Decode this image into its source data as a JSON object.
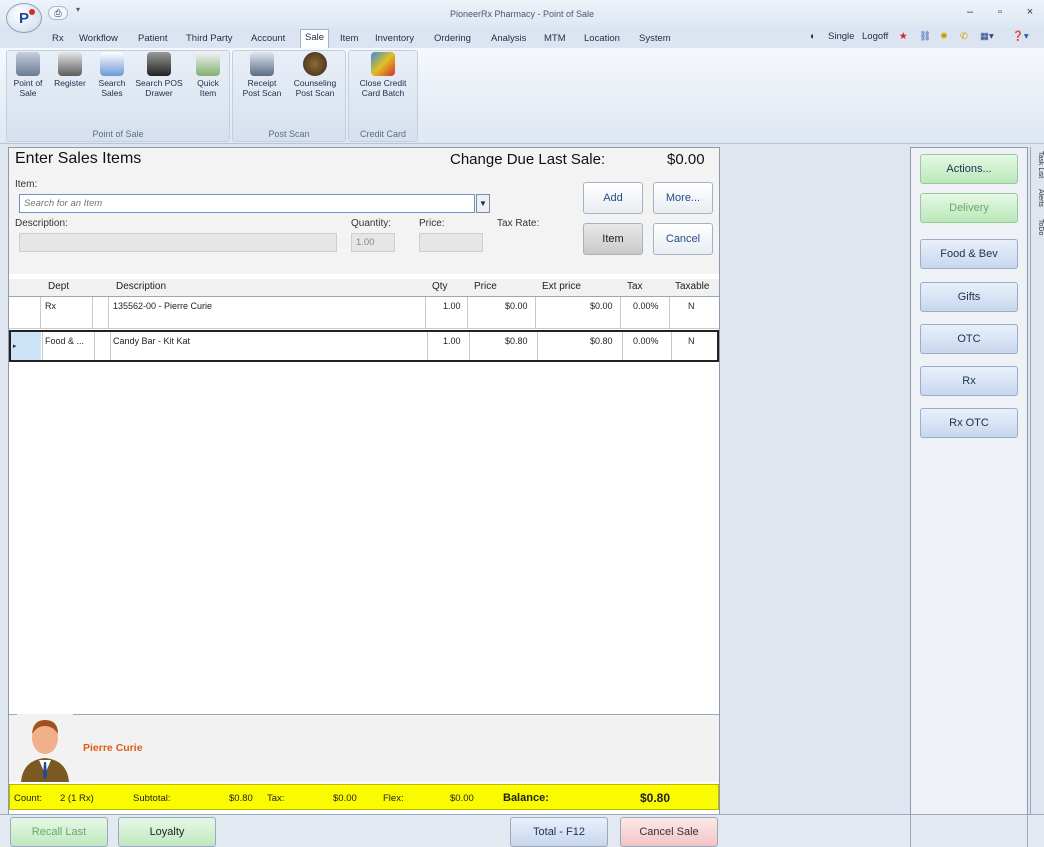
{
  "window": {
    "title": "PioneerRx Pharmacy - Point of Sale",
    "logo": "P",
    "qat_icon": "save-icon",
    "min": "–",
    "max": "▫",
    "close": "×"
  },
  "menu": {
    "items": [
      "Rx",
      "Workflow",
      "Patient",
      "Third Party",
      "Account",
      "Sale",
      "Item",
      "Inventory",
      "Ordering",
      "Analysis",
      "MTM",
      "Location",
      "System"
    ],
    "active": "Sale",
    "right": {
      "single": "Single",
      "logoff": "Logoff"
    }
  },
  "ribbon": {
    "groups": [
      {
        "label": "Point of Sale",
        "buttons": [
          {
            "label": "Point of Sale",
            "icon": "scale-icon"
          },
          {
            "label": "Register",
            "icon": "register-icon"
          },
          {
            "label": "Search Sales",
            "icon": "search-sales-icon"
          },
          {
            "label": "Search POS Drawer",
            "icon": "drawer-icon"
          },
          {
            "label": "Quick Item",
            "icon": "cart-icon"
          }
        ]
      },
      {
        "label": "Post Scan",
        "buttons": [
          {
            "label": "Receipt Post Scan",
            "icon": "receipt-icon"
          },
          {
            "label": "Counseling Post Scan",
            "icon": "counseling-icon"
          }
        ]
      },
      {
        "label": "Credit Card",
        "buttons": [
          {
            "label": "Close Credit Card Batch",
            "icon": "credit-card-icon"
          }
        ]
      }
    ]
  },
  "entry": {
    "title": "Enter Sales Items",
    "change_label": "Change Due Last Sale:",
    "change_value": "$0.00",
    "item_label": "Item:",
    "item_placeholder": "Search for an Item",
    "description_label": "Description:",
    "quantity_label": "Quantity:",
    "quantity_value": "1.00",
    "price_label": "Price:",
    "tax_rate_label": "Tax Rate:",
    "buttons": {
      "add": "Add",
      "more": "More...",
      "item": "Item",
      "cancel": "Cancel"
    }
  },
  "grid": {
    "columns": [
      "Dept",
      "Description",
      "Qty",
      "Price",
      "Ext price",
      "Tax",
      "Taxable"
    ],
    "rows": [
      {
        "dept": "Rx",
        "description": "135562-00 - Pierre Curie",
        "qty": "1.00",
        "price": "$0.00",
        "ext": "$0.00",
        "tax": "0.00%",
        "taxable": "N",
        "selected": false
      },
      {
        "dept": "Food & ...",
        "description": "Candy Bar - Kit Kat",
        "qty": "1.00",
        "price": "$0.80",
        "ext": "$0.80",
        "tax": "0.00%",
        "taxable": "N",
        "selected": true
      }
    ]
  },
  "patient": {
    "name": "Pierre Curie"
  },
  "status": {
    "count_label": "Count:",
    "count_value": "2 (1 Rx)",
    "subtotal_label": "Subtotal:",
    "subtotal_value": "$0.80",
    "tax_label": "Tax:",
    "tax_value": "$0.00",
    "flex_label": "Flex:",
    "flex_value": "$0.00",
    "balance_label": "Balance:",
    "balance_value": "$0.80",
    "color": "#fafa00"
  },
  "bottom": {
    "recall": "Recall Last",
    "loyalty": "Loyalty",
    "total": "Total - F12",
    "cancel_sale": "Cancel Sale"
  },
  "side": {
    "buttons": [
      "Actions...",
      "Delivery",
      "Food & Bev",
      "Gifts",
      "OTC",
      "Rx",
      "Rx OTC"
    ],
    "tabs": [
      "Task List",
      "Alerts",
      "ToDo"
    ]
  }
}
